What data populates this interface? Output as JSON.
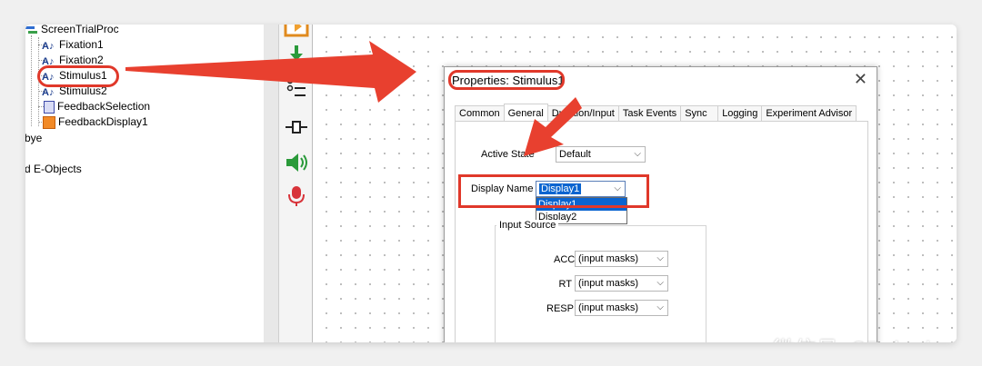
{
  "tree": {
    "items": [
      {
        "label": "ScreenTrialProc",
        "icon": "procedure-icon"
      },
      {
        "label": "Fixation1",
        "icon": "slide-icon"
      },
      {
        "label": "Fixation2",
        "icon": "slide-icon"
      },
      {
        "label": "Stimulus1",
        "icon": "slide-icon"
      },
      {
        "label": "Stimulus2",
        "icon": "slide-icon"
      },
      {
        "label": "FeedbackSelection",
        "icon": "inline-script-icon"
      },
      {
        "label": "FeedbackDisplay1",
        "icon": "feedback-display-icon"
      },
      {
        "label": "bye",
        "icon": ""
      },
      {
        "label": "d E-Objects",
        "icon": ""
      }
    ]
  },
  "dialog": {
    "title": "Properties: Stimulus1",
    "close": "✕",
    "tabs": [
      "Common",
      "General",
      "Duration/Input",
      "Task Events",
      "Sync",
      "Logging",
      "Experiment Advisor"
    ],
    "active_state": {
      "label": "Active State",
      "value": "Default"
    },
    "display_name": {
      "label": "Display Name",
      "value": "Display1",
      "options": [
        "Display1",
        "Display2"
      ]
    },
    "input_source": {
      "title": "Input Source",
      "fields": [
        {
          "label": "ACC",
          "value": "(input masks)"
        },
        {
          "label": "RT",
          "value": "(input masks)"
        },
        {
          "label": "RESP",
          "value": "(input masks)"
        }
      ]
    }
  },
  "watermark": {
    "text": "微信号: CR_brain",
    "icon": "wechat-icon"
  },
  "colors": {
    "highlight": "#e0382a",
    "selection": "#0a64d0"
  }
}
